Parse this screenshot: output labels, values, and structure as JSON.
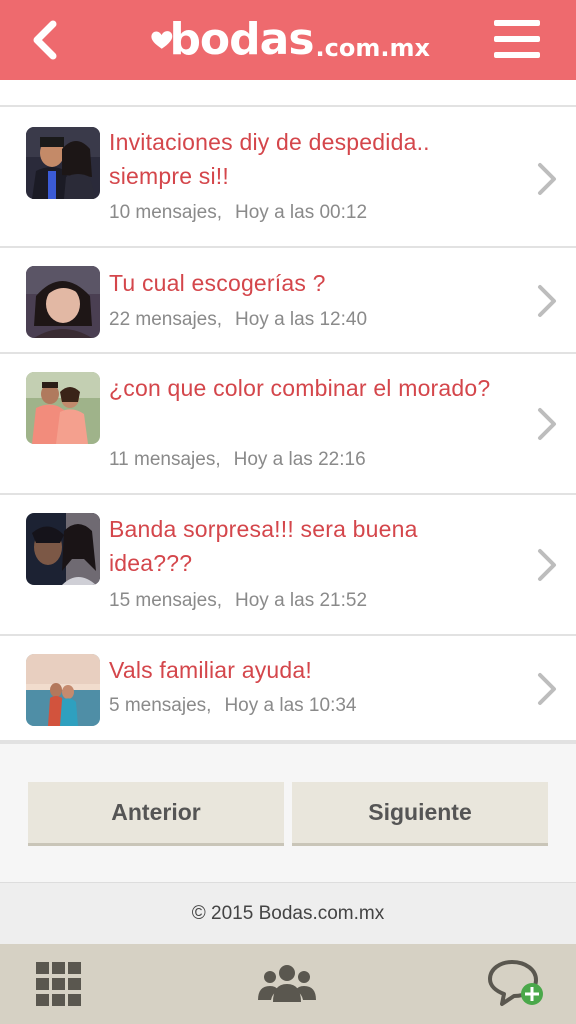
{
  "header": {
    "brand": "bodas",
    "brand_domain": ".com.mx",
    "color": "#ee6a6e"
  },
  "topics": [
    {
      "title": "Invitaciones diy de despedida.. siempre si!!",
      "messages": "10 mensajes,",
      "time": "Hoy a las 00:12",
      "avatar": "couple-avatar"
    },
    {
      "title": "Tu cual escogerías ?",
      "messages": "22 mensajes,",
      "time": "Hoy a las 12:40",
      "avatar": "woman-avatar"
    },
    {
      "title": "¿con que color combinar el morado?",
      "messages": "11 mensajes,",
      "time": "Hoy a las 22:16",
      "avatar": "couple-pink-avatar"
    },
    {
      "title": "Banda sorpresa!!! sera buena idea???",
      "messages": "15 mensajes,",
      "time": "Hoy a las 21:52",
      "avatar": "couple-kiss-avatar"
    },
    {
      "title": "Vals familiar ayuda!",
      "messages": "5 mensajes,",
      "time": "Hoy a las 10:34",
      "avatar": "beach-couple-avatar"
    }
  ],
  "pagination": {
    "prev_label": "Anterior",
    "next_label": "Siguiente"
  },
  "footer": {
    "copyright": "© 2015 Bodas.com.mx"
  },
  "bottom_nav": {
    "items": [
      "grid-icon",
      "community-icon",
      "new-chat-icon"
    ]
  },
  "colors": {
    "accent": "#ee6a6e",
    "title": "#d4464b",
    "button_bg": "#e9e6dc",
    "nav_bg": "#d6d1c4"
  }
}
